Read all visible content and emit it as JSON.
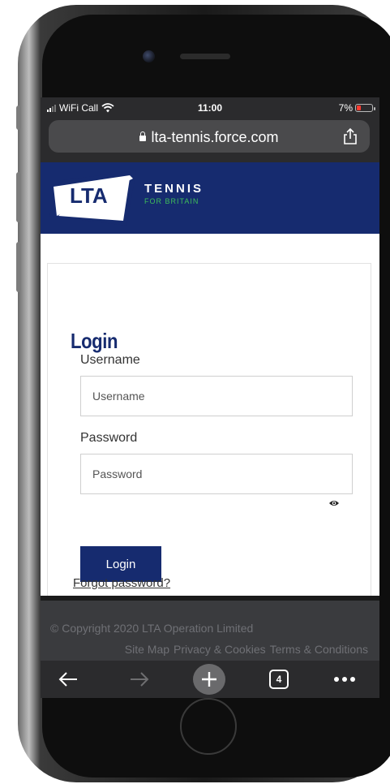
{
  "statusbar": {
    "carrier": "WiFi Call",
    "time": "11:00",
    "battery": "7%",
    "battery_level": 0.07
  },
  "browser": {
    "url": "lta-tennis.force.com",
    "tab_count": "4"
  },
  "site": {
    "logo_text": "LTA",
    "brand_line1": "TENNIS",
    "brand_line2": "FOR BRITAIN",
    "colors": {
      "navy": "#162b6f",
      "green": "#3fbf59"
    }
  },
  "login": {
    "title": "Login",
    "username_label": "Username",
    "username_placeholder": "Username",
    "password_label": "Password",
    "password_placeholder": "Password",
    "submit_label": "Login",
    "forgot_label": "Forgot password?"
  },
  "footer": {
    "copyright": "© Copyright 2020 LTA Operation Limited",
    "links": [
      "Site Map",
      "Privacy & Cookies",
      "Terms & Conditions"
    ]
  },
  "icons": [
    "lock-icon",
    "share-icon",
    "eye-icon",
    "back-arrow-icon",
    "forward-arrow-icon",
    "new-tab-plus-icon",
    "tabs-icon",
    "more-icon",
    "wifi-icon",
    "signal-icon",
    "battery-icon"
  ]
}
